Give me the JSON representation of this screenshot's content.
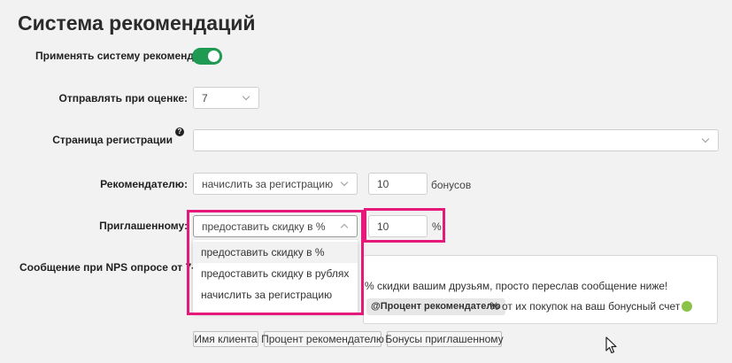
{
  "page": {
    "title": "Система рекомендаций"
  },
  "form": {
    "apply_label": "Применять систему рекомендаций:",
    "apply_enabled": true,
    "send_label": "Отправлять при оценке:",
    "send_value": "7",
    "reg_page_label": "Страница регистрации",
    "reg_help": "?",
    "reg_page_value": "",
    "recommender_label": "Рекомендателю:",
    "recommender_select": "начислить за регистрацию",
    "recommender_amount": "10",
    "recommender_unit": "бонусов",
    "invited_label": "Приглашенному:",
    "invited_select": "предоставить скидку в %",
    "invited_amount": "10",
    "invited_unit": "%",
    "invited_options": [
      "предоставить скидку в %",
      "предоставить скидку в рублях",
      "начислить за регистрацию"
    ],
    "nps_label": "Сообщение при NPS опросе от 7-10:"
  },
  "message": {
    "line1": "% скидки вашим друзьям, просто переслав сообщение ниже!",
    "line2_chip": "@Процент рекомендателю",
    "line2_after": "% от их покупок на ваш бонусный счет"
  },
  "tags": [
    "Имя клиента",
    "Процент рекомендателю",
    "Бонусы приглашенному"
  ],
  "colors": {
    "toggle": "#1e9a52",
    "highlight": "#e6197a"
  },
  "icons": {
    "cursor": "mouse-cursor-icon",
    "emoji": "smiling-face-icon"
  }
}
